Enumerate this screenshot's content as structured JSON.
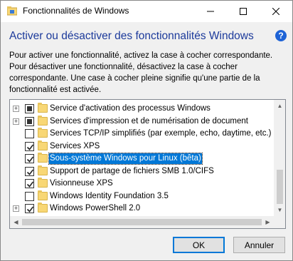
{
  "window": {
    "title": "Fonctionnalités de Windows",
    "icon": "windows-features-icon"
  },
  "titlebar_buttons": {
    "minimize": "minimize-icon",
    "maximize": "maximize-icon",
    "close": "close-icon"
  },
  "heading": "Activer ou désactiver des fonctionnalités Windows",
  "help_icon": "?",
  "description": [
    "Pour activer une fonctionnalité, activez la case à cocher correspondante.",
    "Pour désactiver une fonctionnalité, désactivez la case à cocher",
    "correspondante. Une case à cocher pleine signifie qu'une partie de la",
    "fonctionnalité est activée."
  ],
  "features": [
    {
      "label": "Service d'activation des processus Windows",
      "state": "partial",
      "expandable": true,
      "selected": false
    },
    {
      "label": "Services d'impression et de numérisation de document",
      "state": "partial",
      "expandable": true,
      "selected": false
    },
    {
      "label": "Services TCP/IP simplifiés (par exemple, echo, daytime, etc.)",
      "state": "unchecked",
      "expandable": false,
      "selected": false
    },
    {
      "label": "Services XPS",
      "state": "checked",
      "expandable": false,
      "selected": false
    },
    {
      "label": "Sous-système Windows pour Linux (bêta)",
      "state": "checked",
      "expandable": false,
      "selected": true
    },
    {
      "label": "Support de partage de fichiers SMB 1.0/CIFS",
      "state": "checked",
      "expandable": false,
      "selected": false
    },
    {
      "label": "Visionneuse XPS",
      "state": "checked",
      "expandable": false,
      "selected": false
    },
    {
      "label": "Windows Identity Foundation 3.5",
      "state": "unchecked",
      "expandable": false,
      "selected": false
    },
    {
      "label": "Windows PowerShell 2.0",
      "state": "checked",
      "expandable": true,
      "selected": false
    }
  ],
  "buttons": {
    "ok": "OK",
    "cancel": "Annuler"
  },
  "colors": {
    "heading": "#1c3a9b",
    "selection": "#0078d7",
    "folder": "#f8d775"
  }
}
